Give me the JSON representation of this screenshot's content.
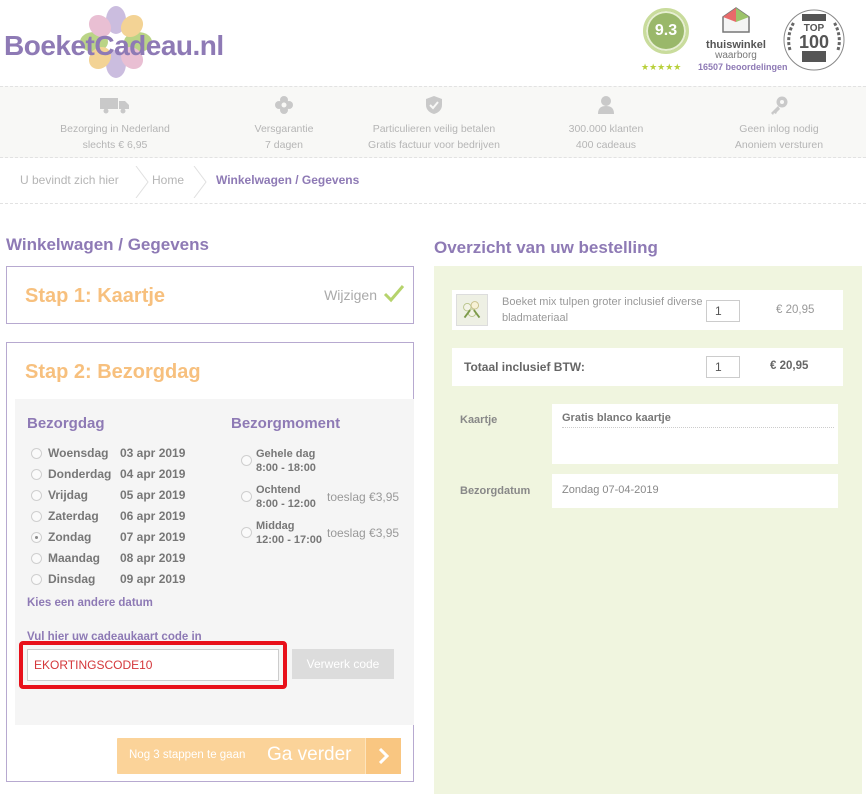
{
  "header": {
    "logo_text": "BoeketCadeau.nl",
    "score": "9.3",
    "stars": "★★★★★",
    "thuiswinkel_name": "thuiswinkel",
    "thuiswinkel_sub": "waarborg",
    "reviews": "16507 beoordelingen",
    "top100_label": "TOP",
    "top100_number": "100"
  },
  "usp": [
    {
      "icon": "truck-icon",
      "line1": "Bezorging in Nederland",
      "line2": "slechts € 6,95"
    },
    {
      "icon": "flower-icon",
      "line1": "Versgarantie",
      "line2": "7 dagen"
    },
    {
      "icon": "shield-icon",
      "line1": "Particulieren veilig betalen",
      "line2": "Gratis factuur voor bedrijven"
    },
    {
      "icon": "person-icon",
      "line1": "300.000 klanten",
      "line2": "400 cadeaus"
    },
    {
      "icon": "key-icon",
      "line1": "Geen inlog nodig",
      "line2": "Anoniem versturen"
    }
  ],
  "breadcrumb": {
    "prefix": "U bevindt zich hier",
    "home": "Home",
    "current": "Winkelwagen / Gegevens"
  },
  "left": {
    "title": "Winkelwagen / Gegevens",
    "step1_title": "Stap 1: Kaartje",
    "step1_edit": "Wijzigen",
    "step2_title": "Stap 2: Bezorgdag",
    "bezorgdag_header": "Bezorgdag",
    "bezorgmoment_header": "Bezorgmoment",
    "days": [
      {
        "name": "Woensdag",
        "date": "03 apr 2019",
        "selected": false
      },
      {
        "name": "Donderdag",
        "date": "04 apr 2019",
        "selected": false
      },
      {
        "name": "Vrijdag",
        "date": "05 apr 2019",
        "selected": false
      },
      {
        "name": "Zaterdag",
        "date": "06 apr 2019",
        "selected": false
      },
      {
        "name": "Zondag",
        "date": "07 apr 2019",
        "selected": true
      },
      {
        "name": "Maandag",
        "date": "08 apr 2019",
        "selected": false
      },
      {
        "name": "Dinsdag",
        "date": "09 apr 2019",
        "selected": false
      }
    ],
    "moments": [
      {
        "name": "Gehele dag",
        "time": "8:00 - 18:00",
        "surcharge": ""
      },
      {
        "name": "Ochtend",
        "time": "8:00 - 12:00",
        "surcharge": "toeslag €3,95"
      },
      {
        "name": "Middag",
        "time": "12:00 - 17:00",
        "surcharge": "toeslag €3,95"
      }
    ],
    "other_date": "Kies een andere datum",
    "code_label": "Vul hier uw cadeaukaart code in",
    "code_value": "EKORTINGSCODE10",
    "code_button": "Verwerk code",
    "next_small": "Nog 3 stappen te gaan",
    "next_big": "Ga verder"
  },
  "right": {
    "title": "Overzicht van uw bestelling",
    "product_name": "Boeket mix tulpen groter inclusief diverse bladmateriaal",
    "product_qty": "1",
    "product_price": "€ 20,95",
    "total_label": "Totaal inclusief BTW:",
    "total_qty": "1",
    "total_price": "€ 20,95",
    "kaartje_label": "Kaartje",
    "kaartje_value": "Gratis blanco kaartje",
    "datum_label": "Bezorgdatum",
    "datum_value": "Zondag 07-04-2019"
  },
  "colors": {
    "brand_purple": "#8e7ab5",
    "step_orange": "#f7c07e",
    "summary_green": "#f0f5df",
    "highlight_red": "#e8101a"
  }
}
